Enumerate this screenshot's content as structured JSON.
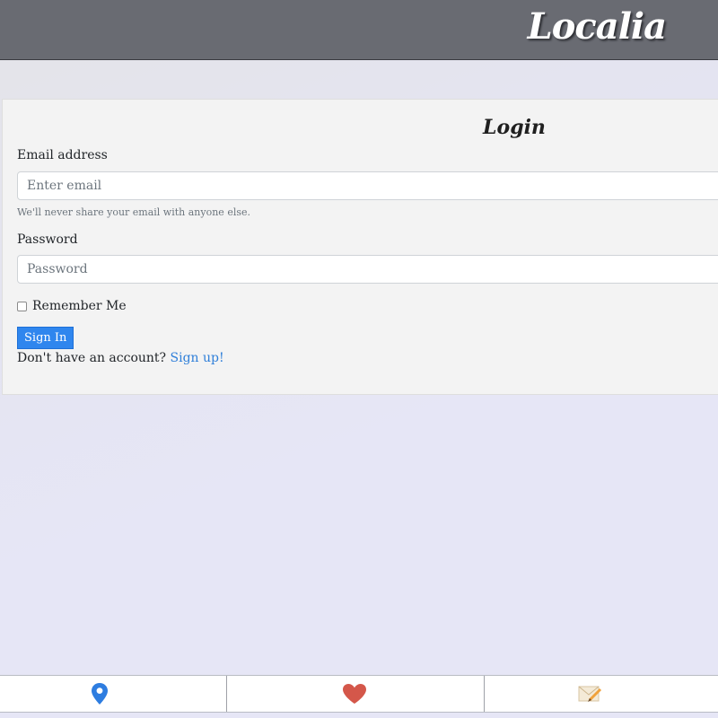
{
  "header": {
    "brand": "Localia"
  },
  "login": {
    "title": "Login",
    "email_label": "Email address",
    "email_placeholder": "Enter email",
    "email_value": "",
    "email_help": "We'll never share your email with anyone else.",
    "password_label": "Password",
    "password_placeholder": "Password",
    "password_value": "",
    "remember_label": "Remember Me",
    "remember_checked": false,
    "submit_label": "Sign In",
    "signup_prompt": "Don't have an account?",
    "signup_link": "Sign up!"
  },
  "footer": {
    "tabs": [
      {
        "icon": "location-pin-icon",
        "color": "#2e7de0"
      },
      {
        "icon": "heart-icon",
        "color": "#d4574a"
      },
      {
        "icon": "envelope-pencil-icon",
        "color": "#e8c88c"
      }
    ]
  },
  "colors": {
    "header_bg": "#696b72",
    "primary": "#2f86ee",
    "link": "#2f7fd9",
    "card_bg": "#f3f3f3",
    "page_bg": "#e6e6f6"
  }
}
